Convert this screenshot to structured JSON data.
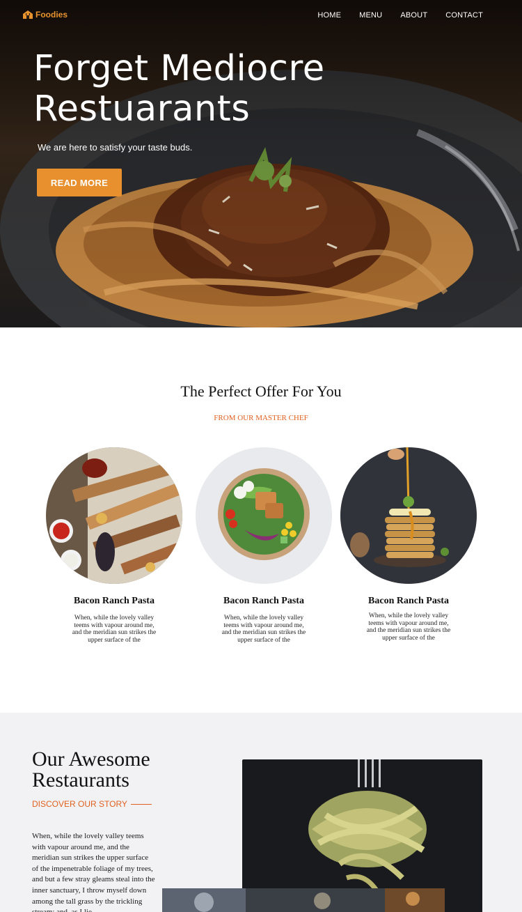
{
  "brand": {
    "name": "Foodies",
    "accent": "#e8942e"
  },
  "nav": [
    {
      "label": "HOME"
    },
    {
      "label": "MENU"
    },
    {
      "label": "ABOUT"
    },
    {
      "label": "CONTACT"
    }
  ],
  "hero": {
    "title_line1": "Forget Mediocre",
    "title_line2": "Restuarants",
    "subtitle": "We are here to satisfy your taste buds.",
    "button": "READ MORE"
  },
  "offer": {
    "title": "The Perfect Offer For You",
    "subtitle": "FROM OUR MASTER CHEF",
    "dishes": [
      {
        "name": "Bacon Ranch Pasta",
        "desc": "When, while the lovely valley teems with vapour around me, and the meridian sun strikes the upper surface of the"
      },
      {
        "name": "Bacon Ranch Pasta",
        "desc": "When, while the lovely valley teems with vapour around me, and the meridian sun strikes the upper surface of the"
      },
      {
        "name": "Bacon Ranch Pasta",
        "desc": "When, while the lovely valley teems with vapour around me, and the meridian sun strikes the upper surface of the"
      }
    ]
  },
  "restaurants": {
    "title_line1": "Our Awesome",
    "title_line2": "Restaurants",
    "subtitle": "DISCOVER OUR STORY",
    "text": "When, while the lovely valley teems with vapour around me, and the meridian sun strikes the upper surface of the impenetrable foliage of my trees, and but a few stray gleams steal into the inner sanctuary, I throw myself down among the tall grass by the trickling stream; and, as I lie"
  }
}
